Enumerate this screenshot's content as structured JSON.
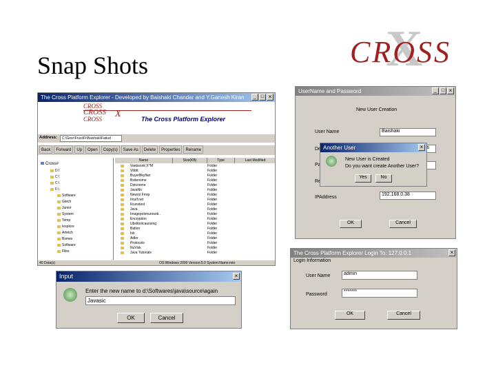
{
  "slide": {
    "title": "Snap Shots"
  },
  "logo": {
    "text": "CROSS",
    "x_mark": "X"
  },
  "explorer": {
    "title": "The Cross Platform Explorer - Developed by Baishaki Chandar and Y.Ganesh Kiran",
    "banner_cross": [
      "CROSS",
      "CROSS",
      "CROSS"
    ],
    "banner_x": "X",
    "banner_title": "The Cross Platform Explorer",
    "address_label": "Address:",
    "address_value": "C:\\Gesr\\Frusi\\Fi\\Baishaki\\Fatiud",
    "toolbar": [
      "Back",
      "Forward",
      "Up",
      "Open",
      "Copy(s)",
      "Save As",
      "Delete",
      "Properties",
      "Rename"
    ],
    "tree": [
      "Cross#",
      "D:\\",
      "C:\\",
      "C:\\",
      "F:\\",
      "Software",
      "Gtech",
      "Junior",
      "System",
      "Temp",
      "Iexplore",
      "Artetch",
      "Bsmes",
      "Software",
      "Files"
    ],
    "columns": [
      "Name",
      "Size(KB)",
      "Type",
      "Last Modified"
    ],
    "files": [
      {
        "name": "Vaebsonk:X^M",
        "type": "Folder"
      },
      {
        "name": "Vbbtt",
        "type": "Folder"
      },
      {
        "name": "BuyerBkyflan",
        "type": "Folder"
      },
      {
        "name": "Bsitenome",
        "type": "Folder"
      },
      {
        "name": "Dstcnome",
        "type": "Folder"
      },
      {
        "name": "JavaNn",
        "type": "Folder"
      },
      {
        "name": "New/ol Fmrp",
        "type": "Folder"
      },
      {
        "name": "Imulf.net",
        "type": "Folder"
      },
      {
        "name": "Ilcunstest",
        "type": "Folder"
      },
      {
        "name": "Java",
        "type": "Folder"
      },
      {
        "name": "Imagepolenurosoti..",
        "type": "Folder"
      },
      {
        "name": "Encryption",
        "type": "Folder"
      },
      {
        "name": "Ubsltoolcaunsing",
        "type": "Folder"
      },
      {
        "name": "Batlon",
        "type": "Folder"
      },
      {
        "name": "Ink",
        "type": "Folder"
      },
      {
        "name": "Adler",
        "type": "Folder"
      },
      {
        "name": "Protocols",
        "type": "Folder"
      },
      {
        "name": "NuVisk",
        "type": "Folder"
      },
      {
        "name": "Java Tutorials",
        "type": "Folder"
      }
    ],
    "status": "40 Dsta(s)",
    "status_os": "OS:Windows 2000 Version:5.0 System:Name:mto"
  },
  "user_window": {
    "title": "UserName and Password",
    "heading": "New User Creation",
    "fields": [
      {
        "label": "User Name",
        "value": "Baishaki"
      },
      {
        "label": "De",
        "value": "ios"
      },
      {
        "label": "Pa",
        "value": ""
      },
      {
        "label": "Re",
        "value": ""
      },
      {
        "label": "IPAddress",
        "value": "192.168.0.38"
      }
    ],
    "ok": "OK",
    "cancel": "Cancel"
  },
  "another_user": {
    "title": "Another User",
    "line1": "New User is Created",
    "line2": "Do you want create Another User?",
    "yes": "Yes",
    "no": "No"
  },
  "input_dialog": {
    "title": "Input",
    "prompt": "Enter the new name to d:\\Softwares\\java\\source\\again",
    "value": "Javasic",
    "ok": "OK",
    "cancel": "Cancel"
  },
  "login_window": {
    "title": "The Cross Platform Explorer   Login  To: 127.0.0.1",
    "heading": "Login Information",
    "user_label": "User Name",
    "user_value": "admin",
    "password_label": "Password",
    "password_value": "*******",
    "ok": "OK",
    "cancel": "Cancel"
  }
}
